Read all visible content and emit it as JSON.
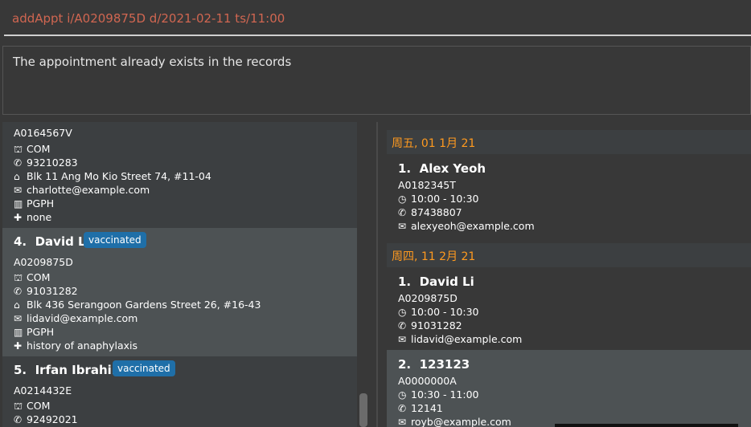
{
  "command": {
    "text": "addAppt i/A0209875D d/2021-02-11 ts/11:00"
  },
  "result": {
    "message": "The appointment already exists in the records"
  },
  "patients": [
    {
      "id": "A0164567V",
      "school": "COM",
      "phone": "93210283",
      "address": "Blk 11 Ang Mo Kio Street 74, #11-04",
      "email": "charlotte@example.com",
      "house": "PGPH",
      "medical": "none"
    },
    {
      "index": "4.",
      "name": "David Li",
      "tag": "vaccinated",
      "id": "A0209875D",
      "school": "COM",
      "phone": "91031282",
      "address": "Blk 436 Serangoon Gardens Street 26, #16-43",
      "email": "lidavid@example.com",
      "house": "PGPH",
      "medical": "history of anaphylaxis"
    },
    {
      "index": "5.",
      "name": "Irfan Ibrahim",
      "tag": "vaccinated",
      "id": "A0214432E",
      "school": "COM",
      "phone": "92492021"
    }
  ],
  "schedule": [
    {
      "date": "周五, 01 1月 21",
      "appointments": [
        {
          "index": "1.",
          "name": "Alex Yeoh",
          "id": "A0182345T",
          "time": "10:00 - 10:30",
          "phone": "87438807",
          "email": "alexyeoh@example.com"
        }
      ]
    },
    {
      "date": "周四, 11 2月 21",
      "appointments": [
        {
          "index": "1.",
          "name": "David Li",
          "id": "A0209875D",
          "time": "10:00 - 10:30",
          "phone": "91031282",
          "email": "lidavid@example.com"
        },
        {
          "index": "2.",
          "name": "123123",
          "id": "A0000000A",
          "time": "10:30 - 11:00",
          "phone": "12141",
          "email": "royb@example.com"
        }
      ]
    }
  ],
  "colors": {
    "accent": "#ff9a1f",
    "command": "#d06651",
    "tag": "#1f6fa8"
  },
  "icons": [
    "school-icon",
    "phone-icon",
    "home-icon",
    "email-icon",
    "building-icon",
    "medical-icon",
    "clock-icon"
  ]
}
